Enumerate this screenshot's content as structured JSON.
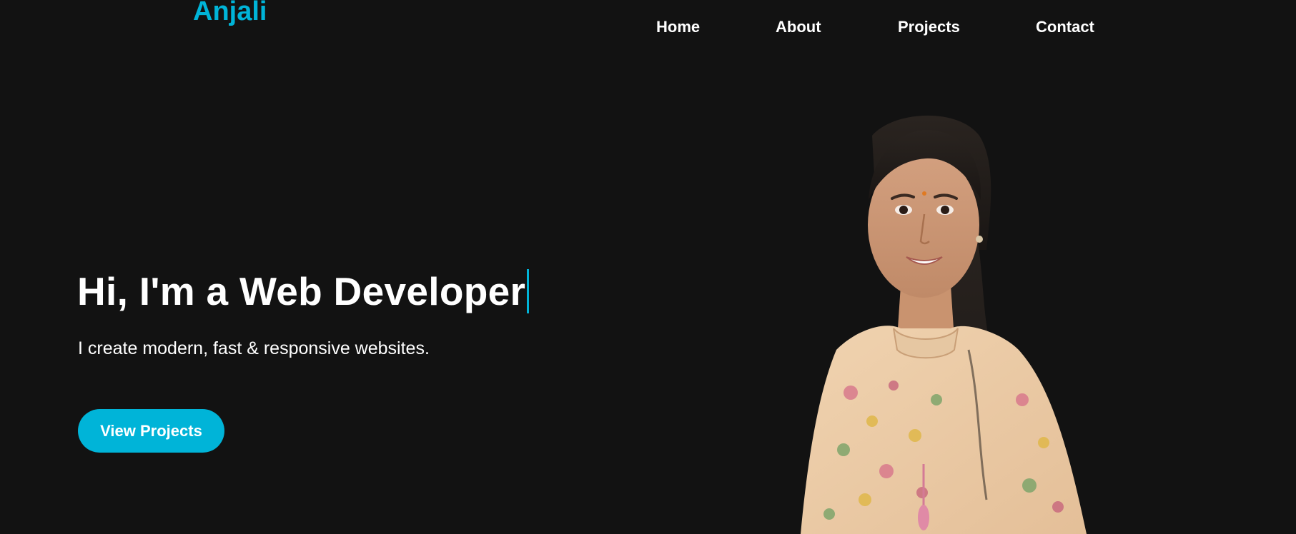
{
  "brand": {
    "logo_text": "Anjali",
    "accent_color": "#00b4d8"
  },
  "nav": {
    "items": [
      {
        "label": "Home"
      },
      {
        "label": "About"
      },
      {
        "label": "Projects"
      },
      {
        "label": "Contact"
      }
    ]
  },
  "hero": {
    "title": "Hi, I'm a Web Developer",
    "subtitle": "I create modern, fast & responsive websites.",
    "cta_label": "View Projects"
  },
  "portrait": {
    "icon": "profile-photo"
  },
  "theme": {
    "background": "#121212",
    "text": "#ffffff"
  }
}
